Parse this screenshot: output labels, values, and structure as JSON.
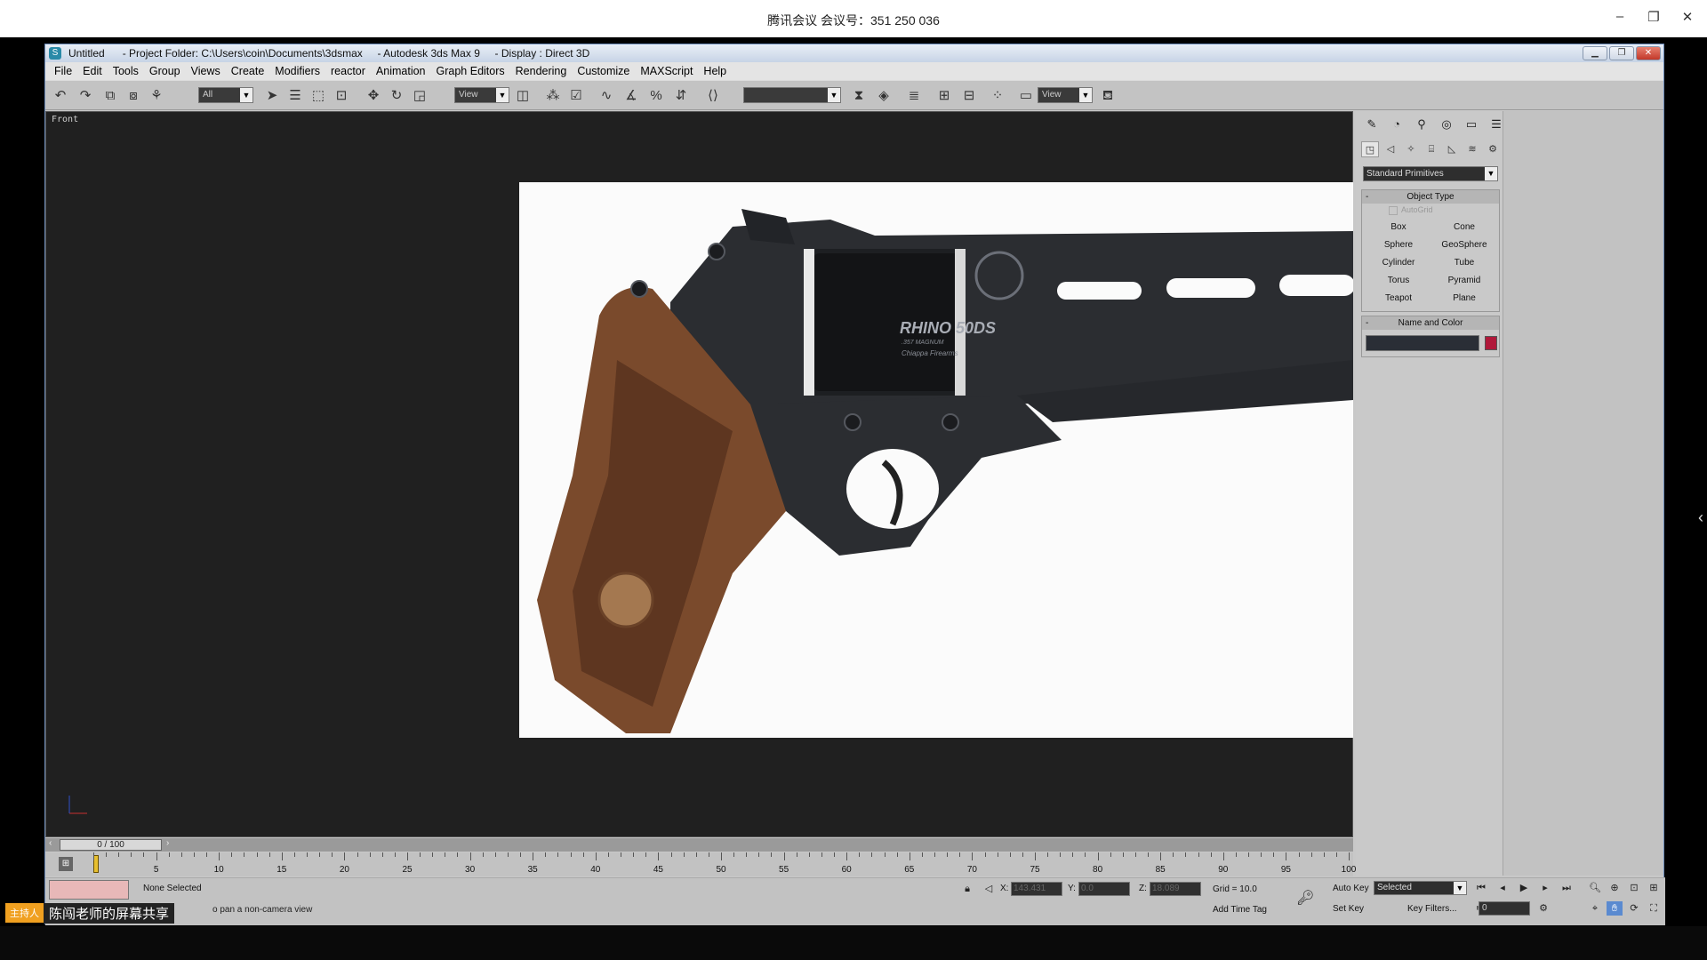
{
  "meeting": {
    "title": "腾讯会议 会议号：351 250 036",
    "controls": [
      "–",
      "❐",
      "✕"
    ],
    "host_badge": "主持人",
    "share_label": "陈闯老师的屏幕共享"
  },
  "max": {
    "title_untitled": "Untitled",
    "title_project": "- Project Folder: C:\\Users\\coin\\Documents\\3dsmax",
    "title_app": "- Autodesk 3ds Max 9",
    "title_display": "- Display : Direct 3D",
    "menu": [
      "File",
      "Edit",
      "Tools",
      "Group",
      "Views",
      "Create",
      "Modifiers",
      "reactor",
      "Animation",
      "Graph Editors",
      "Rendering",
      "Customize",
      "MAXScript",
      "Help"
    ],
    "toolbar": {
      "selection_filter": "All",
      "ref_coord": "View",
      "named_sel": "",
      "render_view": "View"
    },
    "viewport": {
      "label": "Front",
      "ref_text_model": "RHINO  50DS",
      "ref_text_caliber": ".357 MAGNUM",
      "ref_text_maker": "Chiappa Firearms"
    },
    "command_panel": {
      "category": "Standard Primitives",
      "object_type_title": "Object Type",
      "autogrid": "AutoGrid",
      "primitives": [
        "Box",
        "Cone",
        "Sphere",
        "GeoSphere",
        "Cylinder",
        "Tube",
        "Torus",
        "Pyramid",
        "Teapot",
        "Plane"
      ],
      "name_color_title": "Name and Color",
      "swatch_color": "#b0183a"
    },
    "timeline": {
      "frame_display": "0 / 100",
      "ticks": [
        5,
        10,
        15,
        20,
        25,
        30,
        35,
        40,
        45,
        50,
        55,
        60,
        65,
        70,
        75,
        80,
        85,
        90,
        95,
        100
      ]
    },
    "status": {
      "selection": "None Selected",
      "prompt": "o pan a non-camera view",
      "x_label": "X:",
      "x_val": "143.431",
      "y_label": "Y:",
      "y_val": "0.0",
      "z_label": "Z:",
      "z_val": "18.089",
      "grid": "Grid = 10.0",
      "add_time_tag": "Add Time Tag",
      "auto_key": "Auto Key",
      "set_key": "Set Key",
      "key_mode": "Selected",
      "key_filters": "Key Filters...",
      "current_frame": "0"
    }
  }
}
